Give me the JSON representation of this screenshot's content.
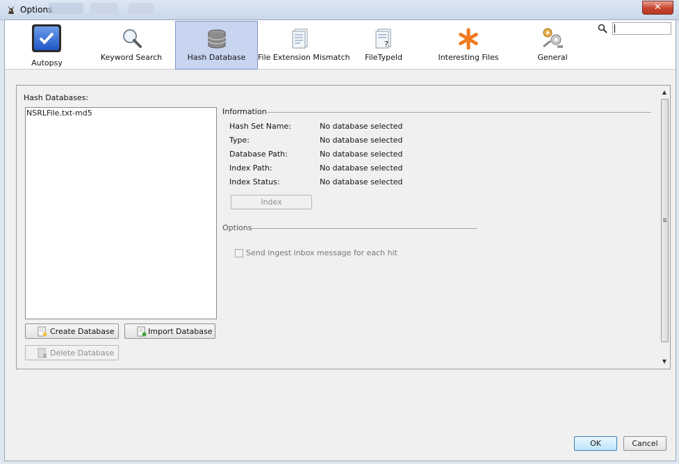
{
  "window": {
    "title": "Options",
    "close_symbol": "✕"
  },
  "toolbar": {
    "items": [
      {
        "label": "Autopsy",
        "icon": "autopsy-check-icon"
      },
      {
        "label": "Keyword Search",
        "icon": "magnifier-icon"
      },
      {
        "label": "Hash Database",
        "icon": "database-icon",
        "selected": true
      },
      {
        "label": "File Extension Mismatch",
        "icon": "file-list-icon"
      },
      {
        "label": "FileTypeId",
        "icon": "file-question-icon"
      },
      {
        "label": "Interesting Files",
        "icon": "asterisk-icon"
      },
      {
        "label": "General",
        "icon": "gears-icon"
      }
    ],
    "search_value": ""
  },
  "hash_panel": {
    "databases_label": "Hash Databases:",
    "databases": [
      "NSRLFile.txt-md5"
    ],
    "create_label": "Create Database",
    "import_label": "Import Database",
    "delete_label": "Delete Database"
  },
  "information": {
    "title": "Information",
    "rows": [
      {
        "label": "Hash Set Name:",
        "value": "No database selected"
      },
      {
        "label": "Type:",
        "value": "No database selected"
      },
      {
        "label": "Database Path:",
        "value": "No database selected"
      },
      {
        "label": "Index Path:",
        "value": "No database selected"
      },
      {
        "label": "Index Status:",
        "value": "No database selected"
      }
    ],
    "index_button": "Index"
  },
  "options": {
    "title": "Options",
    "send_ingest_label": "Send ingest inbox message for each hit",
    "send_ingest_checked": false
  },
  "footer": {
    "ok_label": "OK",
    "cancel_label": "Cancel"
  },
  "colors": {
    "selected_tab_bg": "#c8d5f1",
    "ok_border": "#3c7fb1",
    "asterisk": "#f07a20"
  }
}
